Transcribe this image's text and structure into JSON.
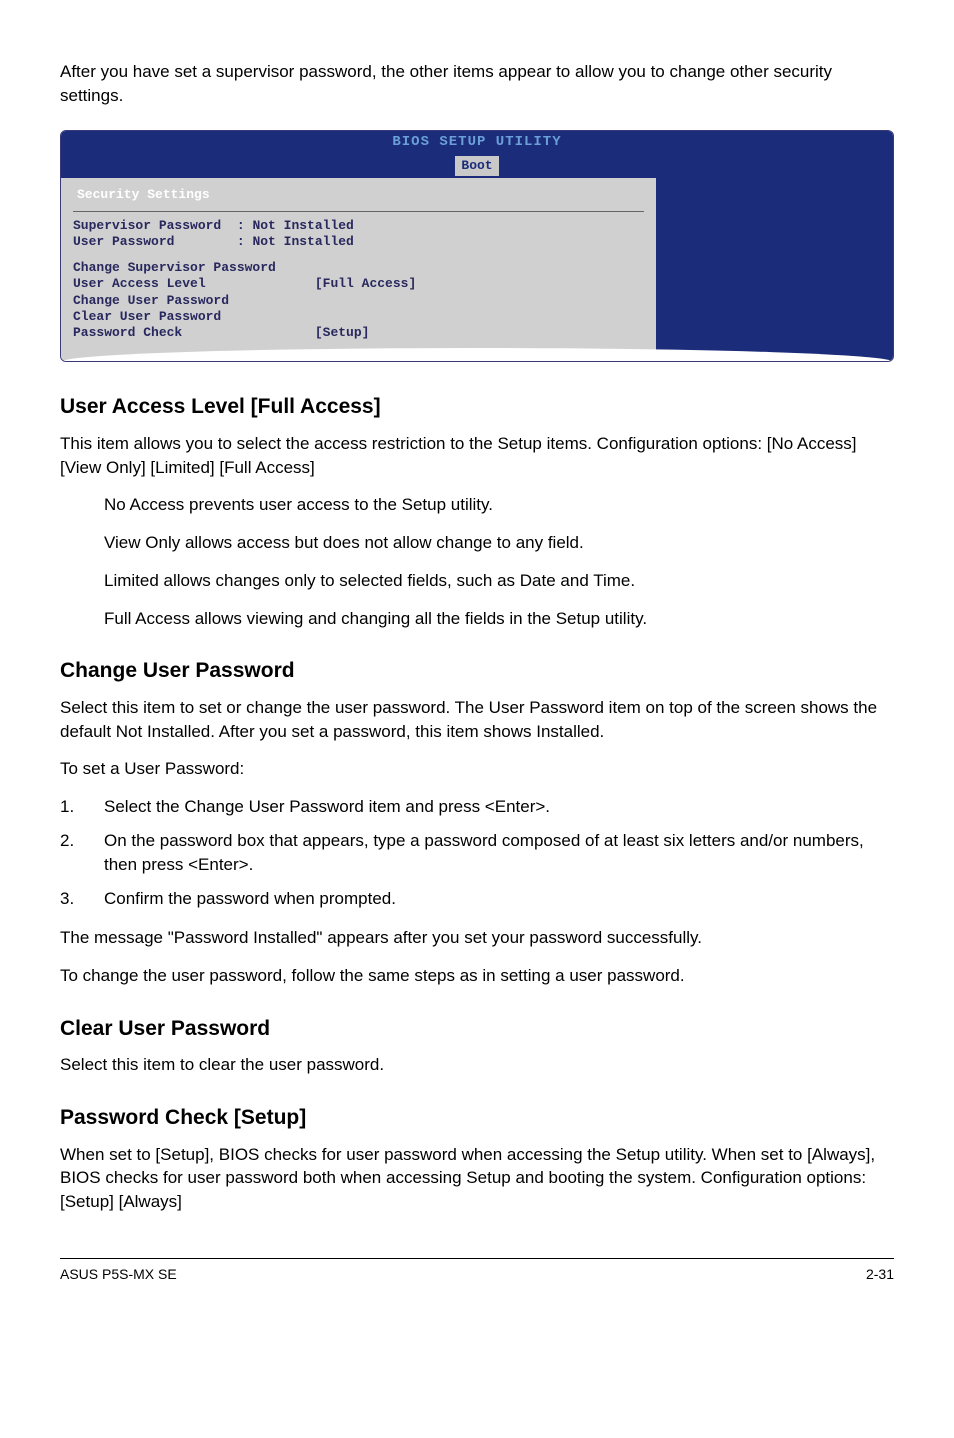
{
  "intro": "After you have set a supervisor password, the other items appear to allow you to change other security settings.",
  "bios": {
    "title": "BIOS SETUP UTILITY",
    "tab": "Boot",
    "section": "Security Settings",
    "supervisor_label": "Supervisor Password",
    "supervisor_value": ": Not Installed",
    "user_label": "User Password",
    "user_value": ": Not Installed",
    "change_supervisor": "Change Supervisor Password",
    "user_access_label": "User Access Level",
    "user_access_value": "[Full Access]",
    "change_user": "Change User Password",
    "clear_user": "Clear User Password",
    "password_check_label": "Password Check",
    "password_check_value": "[Setup]"
  },
  "sections": {
    "user_access": {
      "heading": "User Access Level [Full Access]",
      "p1": "This item allows you to select the access restriction to the Setup items. Configuration options: [No Access] [View Only] [Limited] [Full Access]",
      "bullets": [
        "No Access prevents user access to the Setup utility.",
        "View Only allows access but does not allow change to any field.",
        "Limited allows changes only to selected fields, such as Date and Time.",
        "Full Access allows viewing and changing all the fields in the Setup utility."
      ]
    },
    "change_user": {
      "heading": "Change User Password",
      "p1": "Select this item to set or change the user password. The User Password item on top of the screen shows the default Not Installed. After you set a password, this item shows Installed.",
      "p2": "To set a User Password:",
      "steps": [
        "Select the Change User Password item and press <Enter>.",
        "On the password box that appears, type a password composed of at least six letters and/or numbers, then press <Enter>.",
        "Confirm the password when prompted."
      ],
      "p3": "The message \"Password Installed\" appears after you set your password successfully.",
      "p4": "To change the user password, follow the same steps as in setting a user password."
    },
    "clear_user": {
      "heading": "Clear User Password",
      "p1": "Select this item to clear the user password."
    },
    "password_check": {
      "heading": "Password Check [Setup]",
      "p1": "When set to [Setup], BIOS checks for user password when accessing the Setup utility. When set to [Always], BIOS checks for user password both when accessing Setup and booting the system. Configuration options: [Setup] [Always]"
    }
  },
  "footer": {
    "left": "ASUS P5S-MX SE",
    "right": "2-31"
  }
}
